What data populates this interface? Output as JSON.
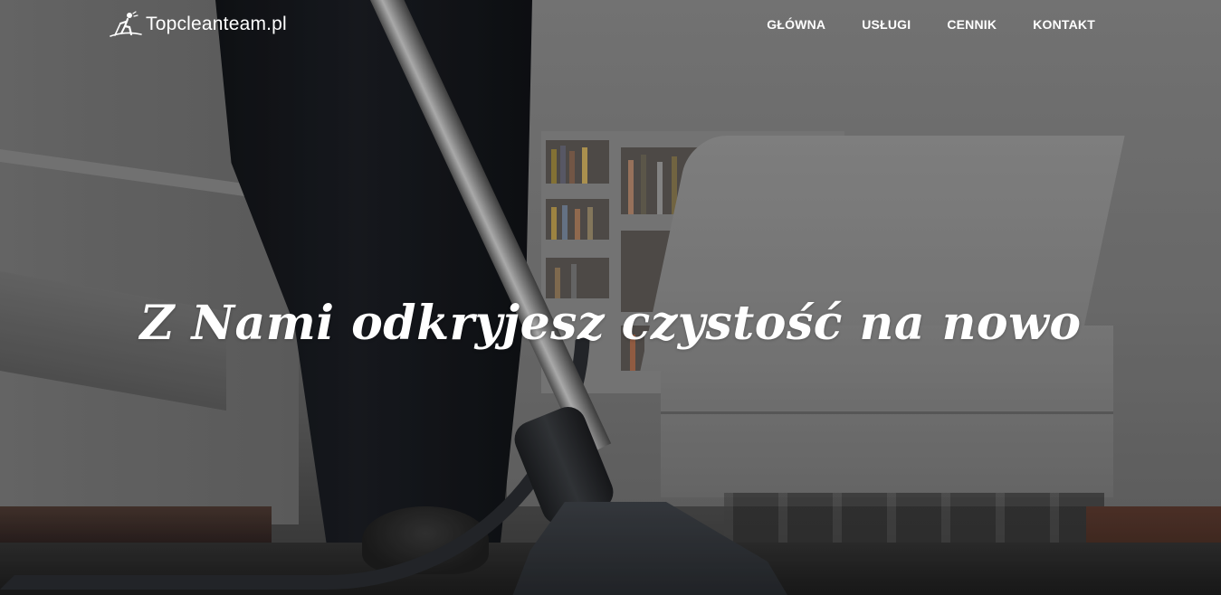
{
  "brand": {
    "name": "Topcleanteam.pl",
    "icon": "cleaner-logo-icon"
  },
  "nav": {
    "items": [
      {
        "label": "GŁÓWNA"
      },
      {
        "label": "USŁUGI"
      },
      {
        "label": "CENNIK"
      },
      {
        "label": "KONTAKT"
      }
    ]
  },
  "hero": {
    "headline": "Z Nami odkryjesz czystość na nowo"
  },
  "colors": {
    "text": "#ffffff"
  }
}
